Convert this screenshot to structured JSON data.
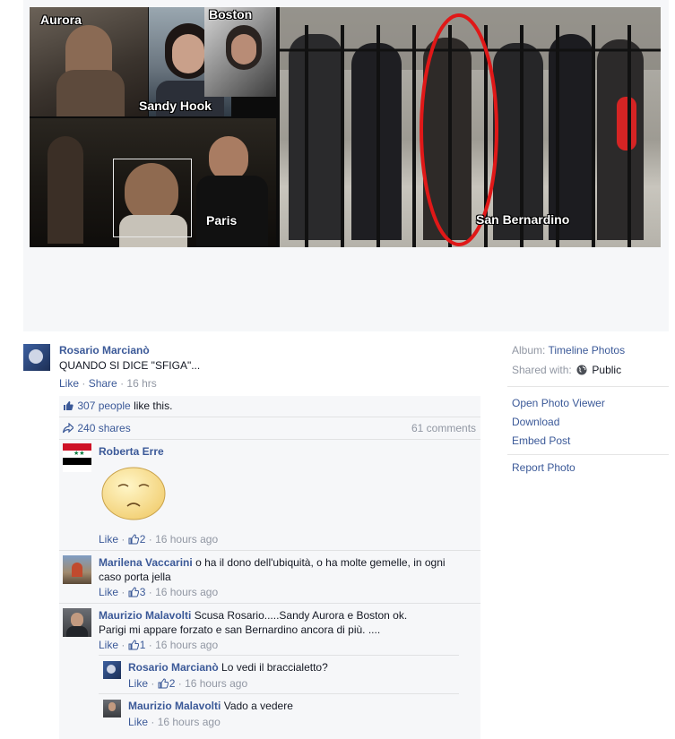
{
  "photo": {
    "captions": {
      "aurora": "Aurora",
      "boston": "Boston",
      "sandy_hook": "Sandy Hook",
      "paris": "Paris",
      "san_bernardino": "San Bernardino"
    }
  },
  "post": {
    "author": "Rosario Marcianò",
    "text": "QUANDO SI DICE \"SFIGA\"...",
    "like_label": "Like",
    "share_label": "Share",
    "time": "16 hrs",
    "separator": "·"
  },
  "ufi": {
    "likes_count": "307 people",
    "likes_suffix": " like this.",
    "shares": "240 shares",
    "comments_count": "61 comments"
  },
  "comments": [
    {
      "author": "Roberta Erre",
      "text": "",
      "like_label": "Like",
      "likes": "2",
      "time": "16 hours ago",
      "sticker": "sad-face-sticker"
    },
    {
      "author": "Marilena Vaccarini",
      "text": "o ha il dono dell'ubiquità, o ha molte gemelle, in ogni caso porta jella",
      "like_label": "Like",
      "likes": "3",
      "time": "16 hours ago"
    },
    {
      "author": "Maurizio Malavolti",
      "text_line1": "Scusa Rosario.....Sandy Aurora e Boston ok.",
      "text_line2": "Parigi mi appare forzato e san Bernardino ancora di più. ....",
      "like_label": "Like",
      "likes": "1",
      "time": "16 hours ago",
      "replies": [
        {
          "author": "Rosario Marcianò",
          "text": "Lo vedi il braccialetto?",
          "like_label": "Like",
          "likes": "2",
          "time": "16 hours ago"
        },
        {
          "author": "Maurizio Malavolti",
          "text": "Vado a vedere",
          "like_label": "Like",
          "time": "16 hours ago"
        }
      ]
    }
  ],
  "sidebar": {
    "album_label": "Album:",
    "album_value": "Timeline Photos",
    "shared_label": "Shared with:",
    "shared_value": "Public",
    "links": [
      "Open Photo Viewer",
      "Download",
      "Embed Post"
    ],
    "report": "Report Photo"
  },
  "colors": {
    "link": "#3b5998",
    "meta": "#9197a3",
    "highlight_ring": "#e01818"
  }
}
